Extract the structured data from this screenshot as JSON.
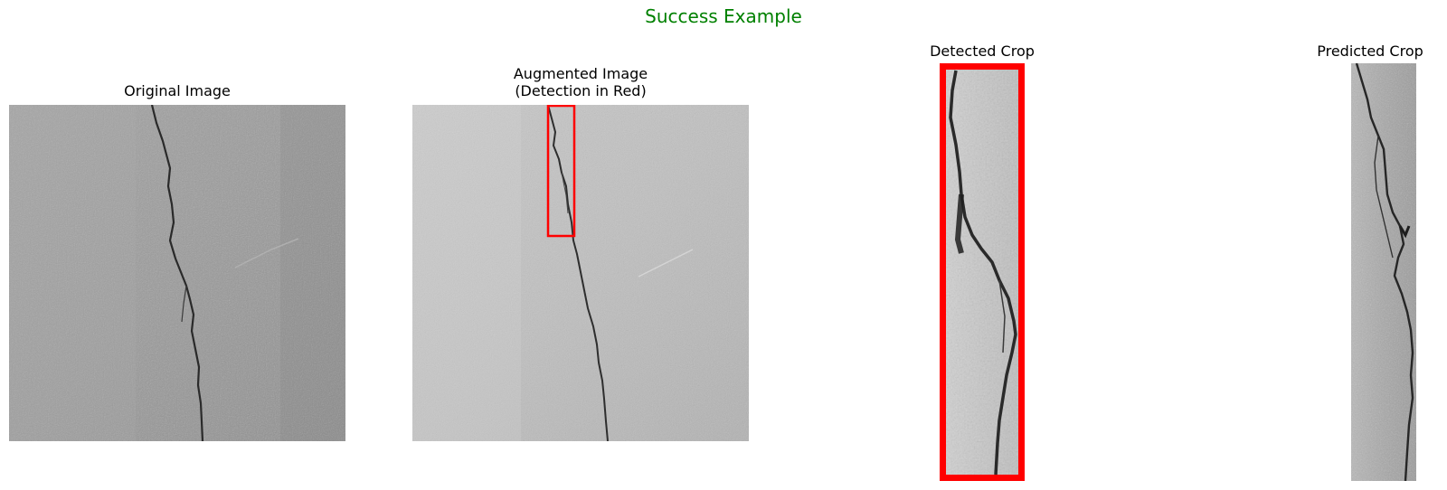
{
  "figure": {
    "suptitle": "Success Example",
    "title_color": "#008000"
  },
  "panels": [
    {
      "title_lines": [
        "Original Image"
      ],
      "image": "concrete surface with a vertical crack"
    },
    {
      "title_lines": [
        "Augmented Image",
        "(Detection in Red)"
      ],
      "image": "brightened concrete surface with red detection box around upper crack",
      "detection_color": "#ff0000"
    },
    {
      "title_lines": [
        "Detected Crop"
      ],
      "image": "narrow crop of crack with thick red border",
      "border_color": "#ff0000"
    },
    {
      "title_lines": [
        "Predicted Crop"
      ],
      "image": "narrow crop of crack"
    }
  ]
}
